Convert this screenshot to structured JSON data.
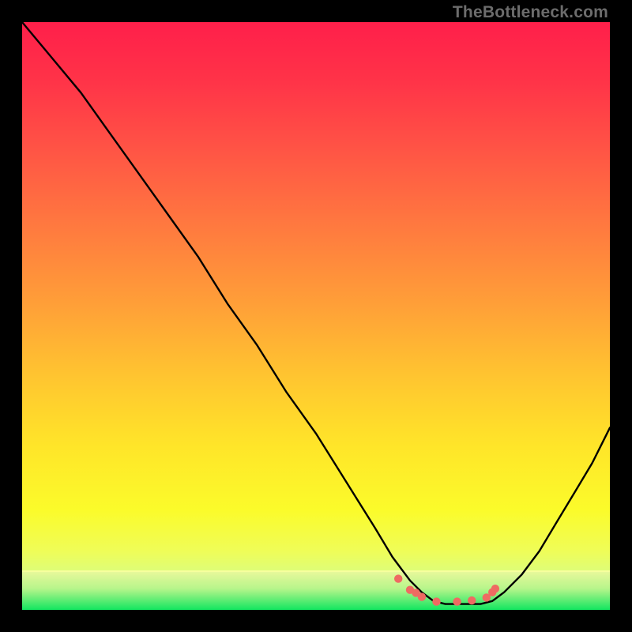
{
  "watermark": "TheBottleneck.com",
  "chart_data": {
    "type": "line",
    "title": "",
    "xlabel": "",
    "ylabel": "",
    "xlim": [
      0,
      100
    ],
    "ylim": [
      0,
      100
    ],
    "grid": false,
    "axes_visible": false,
    "background": "rainbow-vertical-gradient",
    "series": [
      {
        "name": "bottleneck-curve",
        "color": "#000000",
        "x": [
          0,
          5,
          10,
          15,
          20,
          25,
          30,
          35,
          40,
          45,
          50,
          55,
          60,
          63,
          66,
          68,
          70,
          72,
          75,
          78,
          80,
          82,
          85,
          88,
          91,
          94,
          97,
          100
        ],
        "y": [
          100,
          94,
          88,
          81,
          74,
          67,
          60,
          52,
          45,
          37,
          30,
          22,
          14,
          9,
          5,
          3,
          1.5,
          1,
          1,
          1,
          1.5,
          3,
          6,
          10,
          15,
          20,
          25,
          31
        ]
      }
    ],
    "markers": [
      {
        "name": "optimal-range-dots",
        "color": "#ef6a62",
        "x": [
          64,
          66,
          67,
          68,
          70.5,
          74,
          76.5,
          79,
          80,
          80.5
        ],
        "y": [
          5.3,
          3.4,
          2.9,
          2.2,
          1.4,
          1.4,
          1.6,
          2.1,
          3.0,
          3.6
        ]
      }
    ],
    "bottom_band": {
      "name": "green-inner-band",
      "color_top": "#f1fca0",
      "color_bottom": "#13e761",
      "y_range": [
        0,
        7
      ]
    }
  }
}
